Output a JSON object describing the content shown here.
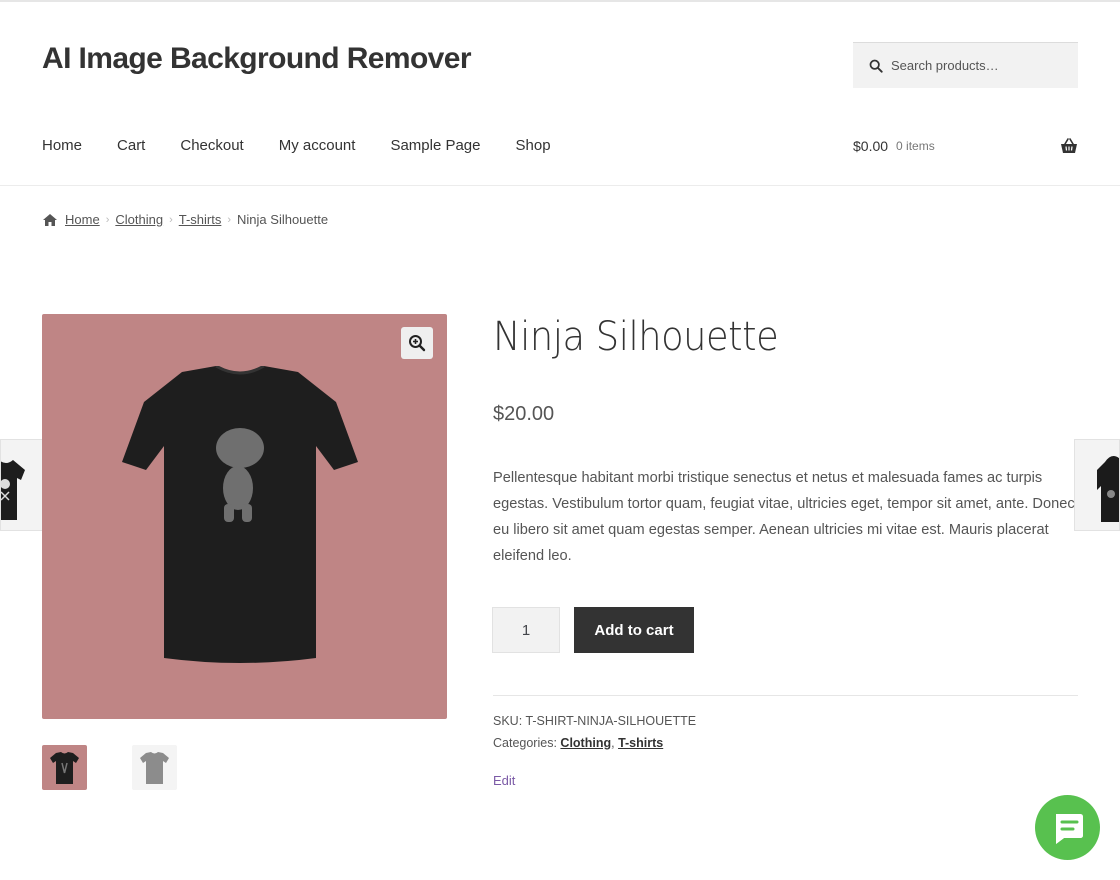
{
  "site": {
    "title": "AI Image Background Remover"
  },
  "search": {
    "placeholder": "Search products…"
  },
  "nav": {
    "items": [
      {
        "label": "Home"
      },
      {
        "label": "Cart"
      },
      {
        "label": "Checkout"
      },
      {
        "label": "My account"
      },
      {
        "label": "Sample Page"
      },
      {
        "label": "Shop"
      }
    ]
  },
  "cart": {
    "amount": "$0.00",
    "count": "0 items",
    "icon": "basket-icon"
  },
  "breadcrumb": {
    "home": "Home",
    "clothing": "Clothing",
    "tshirts": "T-shirts",
    "current": "Ninja Silhouette"
  },
  "product": {
    "title": "Ninja Silhouette",
    "price": "$20.00",
    "description": "Pellentesque habitant morbi tristique senectus et netus et malesuada fames ac turpis egestas. Vestibulum tortor quam, feugiat vitae, ultricies eget, tempor sit amet, ante. Donec eu libero sit amet quam egestas semper. Aenean ultricies mi vitae est. Mauris placerat eleifend leo.",
    "quantity": "1",
    "add_to_cart": "Add to cart",
    "sku_label": "SKU:",
    "sku": "T-SHIRT-NINJA-SILHOUETTE",
    "categories_label": "Categories:",
    "categories": [
      "Clothing",
      "T-shirts"
    ],
    "edit": "Edit"
  },
  "colors": {
    "image_bg": "#bf8585",
    "button": "#333333",
    "chat": "#58c14f",
    "edit_link": "#7b5aa6"
  }
}
